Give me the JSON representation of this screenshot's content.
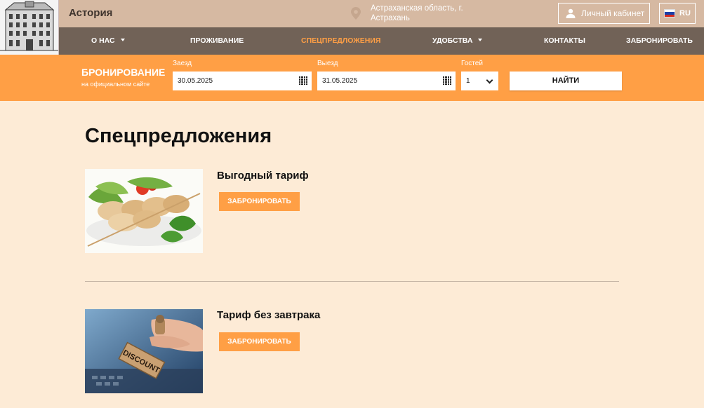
{
  "header": {
    "hotel_name": "Астория",
    "address_line1": "Астраханская область, г.",
    "address_line2": "Астрахань",
    "account_label": "Личный кабинет",
    "language": "RU"
  },
  "nav": {
    "items": [
      {
        "label": "О НАС",
        "has_dropdown": true
      },
      {
        "label": "ПРОЖИВАНИЕ"
      },
      {
        "label": "СПЕЦПРЕДЛОЖЕНИЯ",
        "active": true
      },
      {
        "label": "УДОБСТВА",
        "has_dropdown": true
      },
      {
        "label": "КОНТАКТЫ"
      },
      {
        "label": "ЗАБРОНИРОВАТЬ"
      }
    ]
  },
  "booking": {
    "title": "БРОНИРОВАНИЕ",
    "subtitle": "на официальном сайте",
    "checkin_label": "Заезд",
    "checkin_value": "30.05.2025",
    "checkout_label": "Выезд",
    "checkout_value": "31.05.2025",
    "guests_label": "Гостей",
    "guests_value": "1",
    "search_label": "НАЙТИ"
  },
  "main": {
    "page_title": "Спецпредложения",
    "offers": [
      {
        "title": "Выгодный тариф",
        "button_label": "ЗАБРОНИРОВАТЬ",
        "image": "food-skewer-image"
      },
      {
        "title": "Тариф без завтрака",
        "button_label": "ЗАБРОНИРОВАТЬ",
        "image": "discount-stamp-image"
      }
    ]
  },
  "colors": {
    "topbar": "#d6b9a2",
    "nav": "#716257",
    "accent": "#ff9f45",
    "page_bg": "#fdebd6"
  }
}
